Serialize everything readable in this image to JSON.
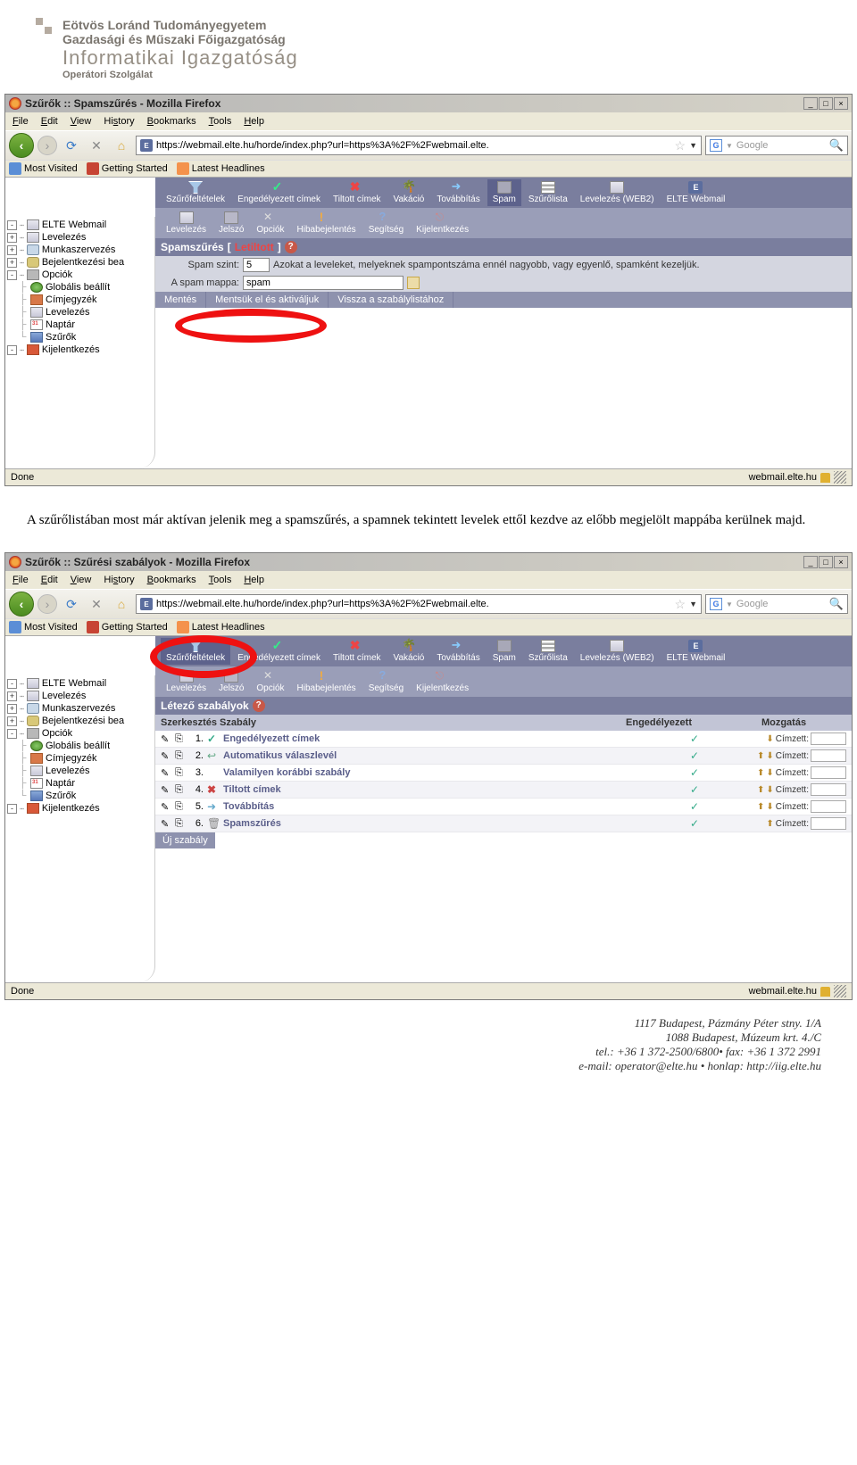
{
  "header": {
    "line1": "Eötvös Loránd Tudományegyetem",
    "line2": "Gazdasági és Műszaki Főigazgatóság",
    "line3": "Informatikai Igazgatóság",
    "line4": "Operátori Szolgálat"
  },
  "browser1": {
    "title": "Szűrők :: Spamszűrés - Mozilla Firefox",
    "url": "https://webmail.elte.hu/horde/index.php?url=https%3A%2F%2Fwebmail.elte.",
    "search_placeholder": "Google",
    "status_left": "Done",
    "status_right": "webmail.elte.hu"
  },
  "browser2": {
    "title": "Szűrők :: Szűrési szabályok - Mozilla Firefox",
    "url": "https://webmail.elte.hu/horde/index.php?url=https%3A%2F%2Fwebmail.elte.",
    "search_placeholder": "Google",
    "status_left": "Done",
    "status_right": "webmail.elte.hu"
  },
  "menubar": [
    "File",
    "Edit",
    "View",
    "History",
    "Bookmarks",
    "Tools",
    "Help"
  ],
  "bookmarks": [
    "Most Visited",
    "Getting Started",
    "Latest Headlines"
  ],
  "sidebar": {
    "items": [
      "ELTE Webmail",
      "Levelezés",
      "Munkaszervezés",
      "Bejelentkezési bea",
      "Opciók",
      "Globális beállít",
      "Címjegyzék",
      "Levelezés",
      "Naptár",
      "Szűrők",
      "Kijelentkezés"
    ]
  },
  "toolbar_top": [
    "Szűrőfeltételek",
    "Engedélyezett címek",
    "Tiltott címek",
    "Vakáció",
    "Továbbítás",
    "Spam",
    "Szűrőlista",
    "Levelezés (WEB2)",
    "ELTE Webmail"
  ],
  "toolbar_sub": [
    "Levelezés",
    "Jelszó",
    "Opciók",
    "Hibabejelentés",
    "Segítség",
    "Kijelentkezés"
  ],
  "spam": {
    "heading": "Spamszűrés",
    "status": "Letiltott",
    "row1_label": "Spam szint:",
    "row1_value": "5",
    "row1_desc": "Azokat a leveleket, melyeknek spampontszáma ennél nagyobb, vagy egyenlő, spamként kezeljük.",
    "row2_label": "A spam mappa:",
    "row2_value": "spam",
    "btn_save": "Mentés",
    "btn_save_activate": "Mentsük el és aktiváljuk",
    "btn_back": "Vissza a szabálylistához"
  },
  "body_text": "A szűrőlistában most már aktívan jelenik meg a spamszűrés, a spamnek tekintett levelek ettől kezdve az előbb megjelölt mappába kerülnek majd.",
  "rules": {
    "heading": "Létező szabályok",
    "col1": "Szerkesztés Szabály",
    "col2": "Engedélyezett",
    "col3": "Mozgatás",
    "move_label": "Címzett:",
    "new_rule": "Új szabály",
    "list": [
      {
        "n": "1.",
        "ico": "check",
        "name": "Engedélyezett címek",
        "up": false,
        "dn": true
      },
      {
        "n": "2.",
        "ico": "reply",
        "name": "Automatikus válaszlevél",
        "up": true,
        "dn": true
      },
      {
        "n": "3.",
        "ico": "none",
        "name": "Valamilyen korábbi szabály",
        "up": true,
        "dn": true
      },
      {
        "n": "4.",
        "ico": "x",
        "name": "Tiltott címek",
        "up": true,
        "dn": true
      },
      {
        "n": "5.",
        "ico": "fwd",
        "name": "Továbbítás",
        "up": true,
        "dn": true
      },
      {
        "n": "6.",
        "ico": "spam",
        "name": "Spamszűrés",
        "up": true,
        "dn": false
      }
    ]
  },
  "footer": {
    "l1": "1117 Budapest, Pázmány Péter stny. 1/A",
    "l2": "1088 Budapest, Múzeum krt. 4./C",
    "l3": "tel.: +36 1 372-2500/6800• fax: +36 1 372 2991",
    "l4": "e-mail: operator@elte.hu • honlap: http://iig.elte.hu"
  }
}
